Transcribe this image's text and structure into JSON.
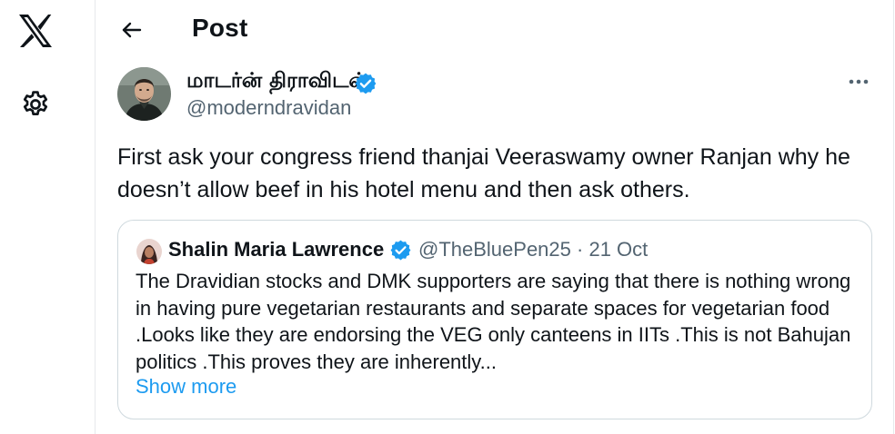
{
  "header": {
    "title": "Post"
  },
  "tweet": {
    "author_name": "மாடர்ன் திராவிடன்",
    "author_handle": "@moderndravidan",
    "text": "First ask your congress friend thanjai Veeraswamy owner Ranjan why he doesn’t allow beef in his hotel menu and then ask others."
  },
  "quoted": {
    "author_name": "Shalin Maria Lawrence",
    "author_handle": "@TheBluePen25",
    "separator": "·",
    "date": "21 Oct",
    "text": "The Dravidian stocks and DMK supporters are saying that there is nothing wrong in having pure vegetarian restaurants and separate spaces for vegetarian food .Looks like they are endorsing the VEG only canteens in IITs .This is not Bahujan politics .This proves they are inherently...",
    "show_more": "Show more"
  },
  "icons": {
    "logo": "x-logo-icon",
    "settings": "gear-icon",
    "back": "arrow-left-icon",
    "verified": "verified-badge-icon",
    "more": "more-horizontal-icon"
  },
  "colors": {
    "accent": "#1d9bf0",
    "text": "#0f1419",
    "secondary_text": "#536471",
    "border": "#cfd9de"
  }
}
